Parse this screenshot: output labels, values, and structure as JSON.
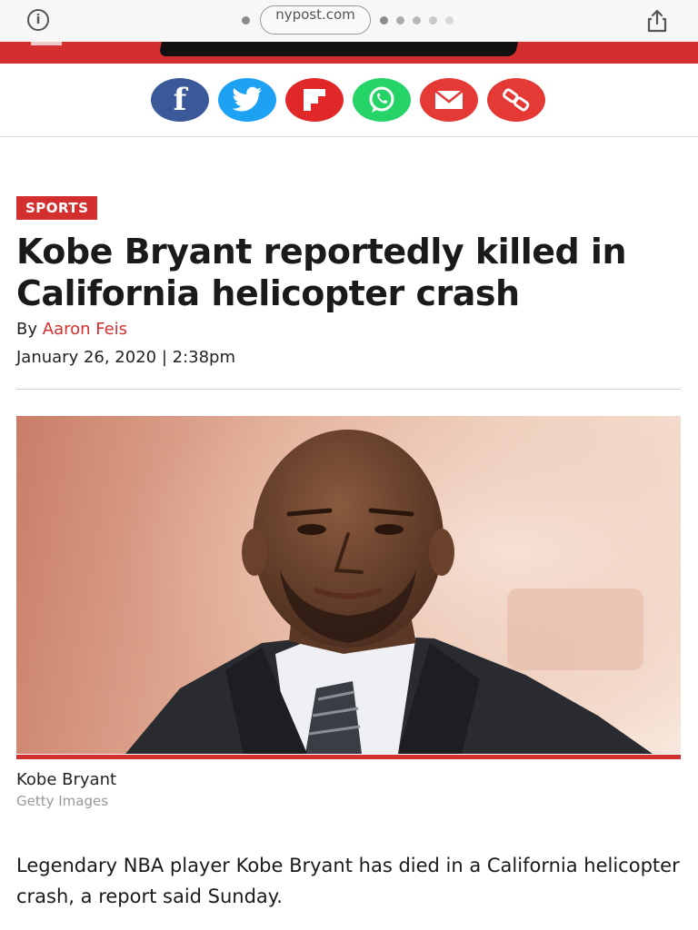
{
  "browser": {
    "url": "nypost.com",
    "icons": [
      "info-icon",
      "share-icon"
    ]
  },
  "social": {
    "buttons": [
      {
        "name": "facebook",
        "glyph": "f",
        "color": "#3b5998"
      },
      {
        "name": "twitter",
        "glyph": "🐦",
        "color": "#1da1f2"
      },
      {
        "name": "flipboard",
        "glyph": "F",
        "color": "#e12828"
      },
      {
        "name": "whatsapp",
        "glyph": "✆",
        "color": "#25d366"
      },
      {
        "name": "email",
        "glyph": "✉",
        "color": "#e53935"
      },
      {
        "name": "link",
        "glyph": "⛓",
        "color": "#e53935"
      }
    ]
  },
  "article": {
    "section": "SPORTS",
    "headline": "Kobe Bryant reportedly killed in California helicopter crash",
    "byline_prefix": "By",
    "author": "Aaron Feis",
    "date": "January 26, 2020 | 2:38pm",
    "photo_caption": "Kobe Bryant",
    "photo_credit": "Getty Images",
    "lede": "Legendary NBA player Kobe Bryant has died in a California helicopter crash, a report said Sunday."
  },
  "colors": {
    "brand_red": "#d32f2f"
  }
}
